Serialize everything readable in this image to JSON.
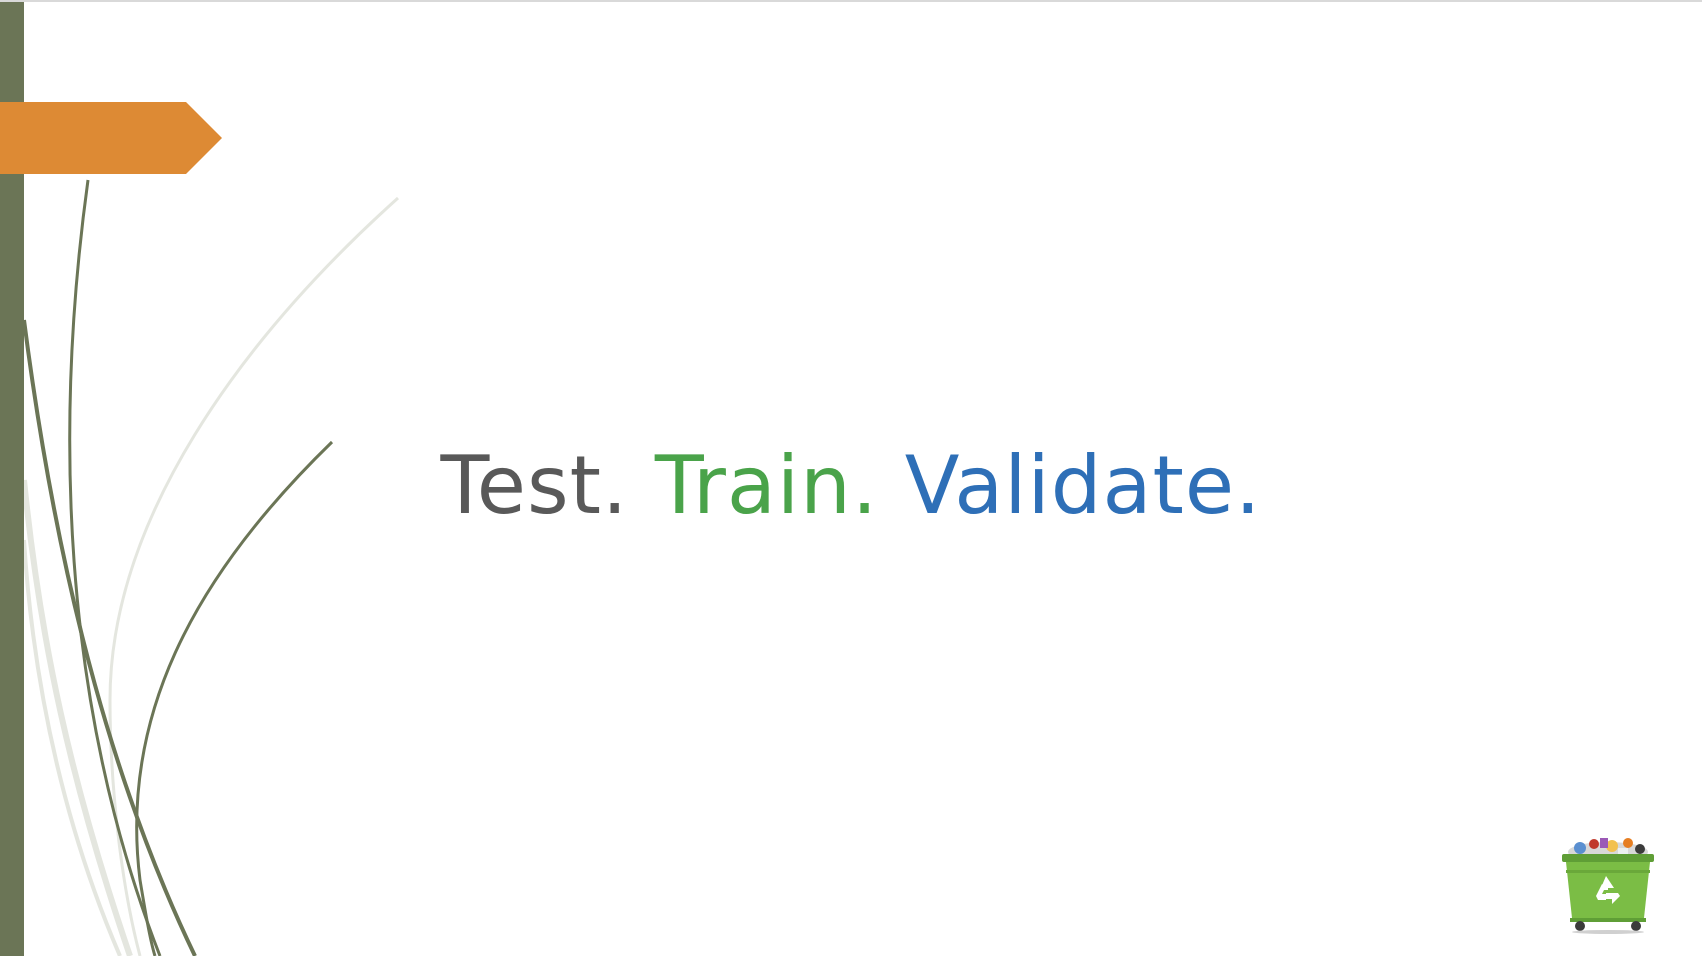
{
  "slide": {
    "title": {
      "word1": "Test.",
      "word2": "Train.",
      "word3": "Validate."
    }
  },
  "colors": {
    "word1": "#595959",
    "word2": "#4aa34a",
    "word3": "#2e6fb7",
    "left_bar": "#6b7556",
    "tag": "#dd8a34",
    "curve_dark": "#6b7556",
    "curve_light": "#e4e6df",
    "dumpster_body": "#7bbd45"
  },
  "icons": {
    "dumpster": "recycling-dumpster-icon",
    "recycle": "recycle-symbol-icon"
  }
}
